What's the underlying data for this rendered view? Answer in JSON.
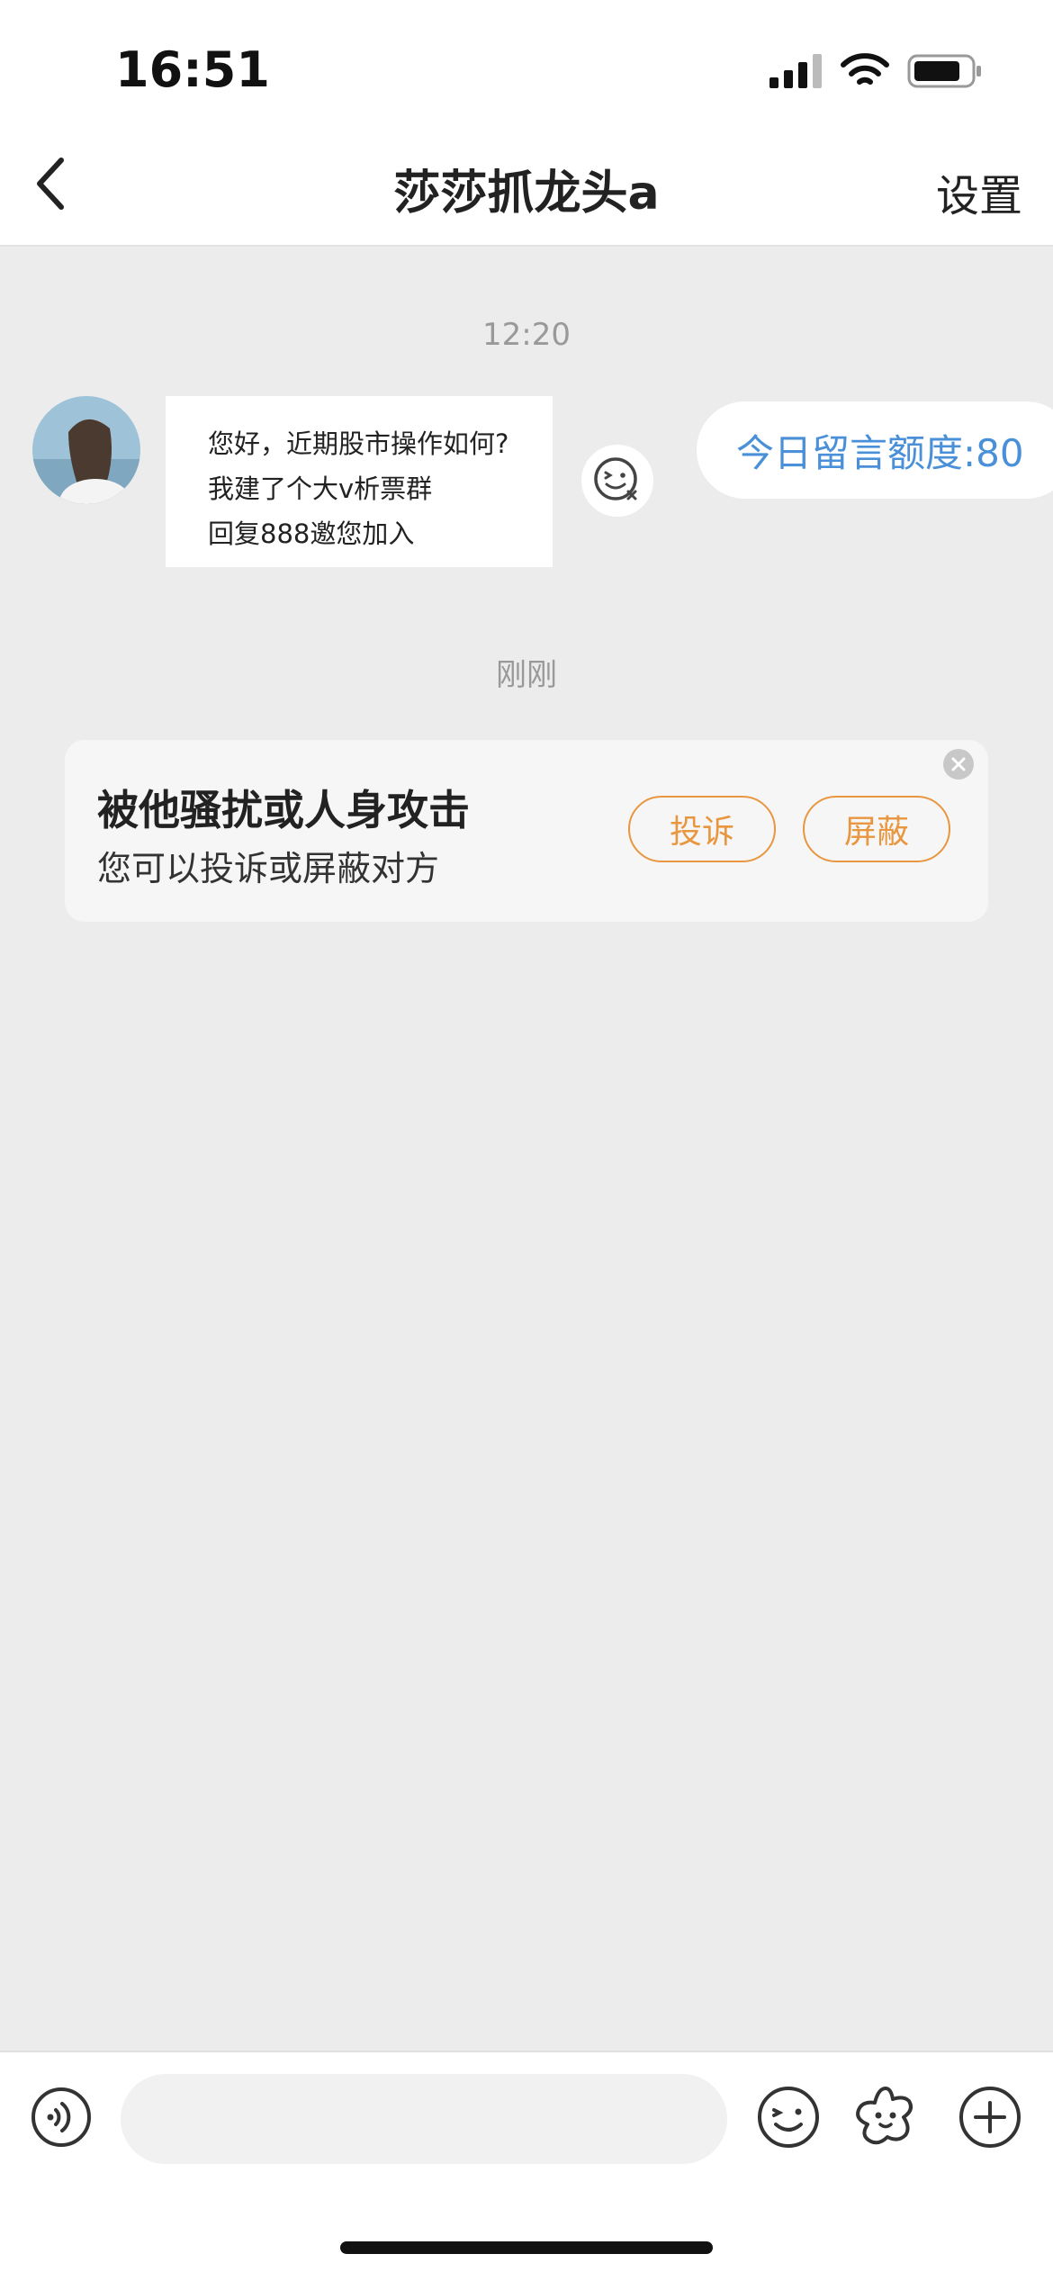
{
  "status_bar": {
    "time": "16:51",
    "icons": [
      "signal-icon",
      "wifi-icon",
      "battery-icon"
    ]
  },
  "header": {
    "back_icon": "chevron-left-icon",
    "title": "莎莎抓龙头a",
    "settings_label": "设置"
  },
  "chat": {
    "timestamp_1": "12:20",
    "incoming_message": {
      "lines": [
        "您好，近期股市操作如何?",
        "我建了个大v析票群",
        "回复888邀您加入"
      ]
    },
    "quota_label": "今日留言额度:80",
    "timestamp_2": "刚刚"
  },
  "report_card": {
    "title": "被他骚扰或人身攻击",
    "subtitle": "您可以投诉或屏蔽对方",
    "complain_label": "投诉",
    "block_label": "屏蔽"
  },
  "input_bar": {
    "placeholder": "",
    "icons": [
      "voice-icon",
      "emoji-icon",
      "sticker-icon",
      "plus-icon"
    ]
  },
  "colors": {
    "accent_orange": "#e8963f",
    "accent_blue": "#4a90d9",
    "background": "#ececec"
  }
}
